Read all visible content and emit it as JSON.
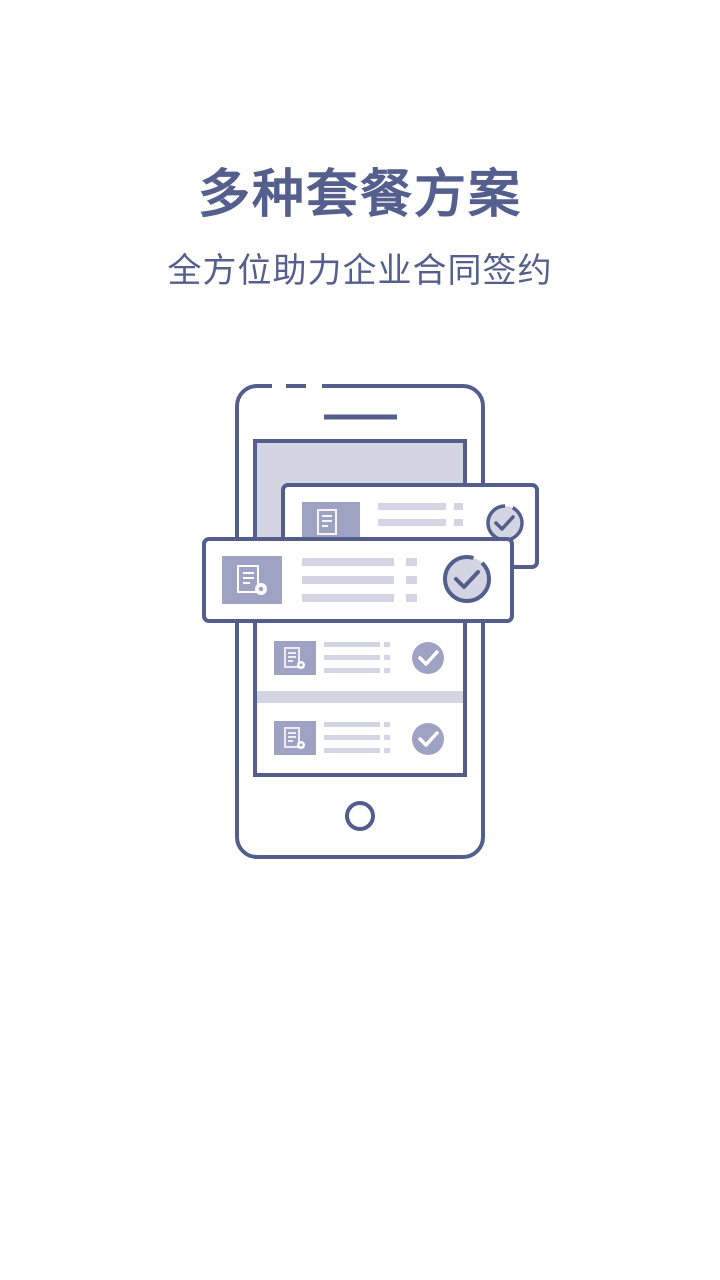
{
  "onboarding": {
    "title": "多种套餐方案",
    "subtitle": "全方位助力企业合同签约"
  },
  "illustration": {
    "icon": "phone-with-contract-cards-icon",
    "colors": {
      "stroke": "#535e8c",
      "fill_dark": "#9ea3c4",
      "fill_light": "#d3d6e2",
      "background": "#ffffff"
    }
  }
}
